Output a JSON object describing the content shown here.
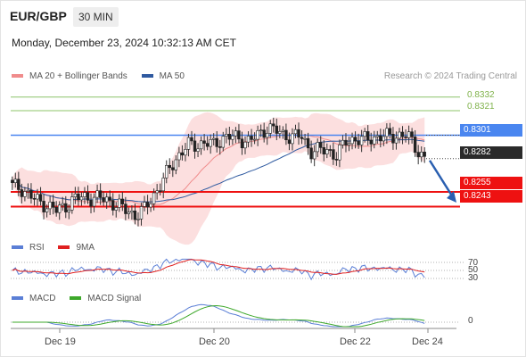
{
  "header": {
    "symbol": "EUR/GBP",
    "timeframe": "30 MIN",
    "timestamp": "Monday, December 23, 2024 10:32:13 AM CET"
  },
  "main_legend": {
    "items": [
      {
        "label": "MA 20 + Bollinger Bands",
        "color": "#f08c8c"
      },
      {
        "label": "MA 50",
        "color": "#2f5aa0"
      }
    ],
    "credit": "Research © 2024 Trading Central"
  },
  "price_labels": {
    "r2": "0.8332",
    "r1": "0.8321",
    "pivot": "0.8301",
    "last": "0.8282",
    "s1": "0.8255",
    "s2": "0.8243"
  },
  "rsi_legend": {
    "items": [
      {
        "label": "RSI",
        "color": "#5b7fd6"
      },
      {
        "label": "9MA",
        "color": "#e02020"
      }
    ],
    "levels": [
      "70",
      "50",
      "30"
    ]
  },
  "macd_legend": {
    "items": [
      {
        "label": "MACD",
        "color": "#5b7fd6"
      },
      {
        "label": "MACD Signal",
        "color": "#3da82a"
      }
    ],
    "zero": "0"
  },
  "x_axis": {
    "labels": [
      "Dec 19",
      "Dec 20",
      "Dec 22",
      "Dec 24"
    ]
  },
  "chart_data": {
    "type": "candlestick",
    "y_range": [
      0.8226,
      0.8342
    ],
    "levels": {
      "r2": 0.8332,
      "r1": 0.8321,
      "pivot": 0.8301,
      "s1": 0.8255,
      "s2": 0.8243,
      "last": 0.8282
    },
    "close_path": [
      0.826,
      0.8258,
      0.8252,
      0.8247,
      0.8244,
      0.824,
      0.8243,
      0.8249,
      0.8251,
      0.825,
      0.825,
      0.8248,
      0.8244,
      0.824,
      0.8236,
      0.824,
      0.8251,
      0.8262,
      0.8275,
      0.8285,
      0.8293,
      0.8293,
      0.8295,
      0.8293,
      0.8299,
      0.83,
      0.8298,
      0.8296,
      0.8301,
      0.8307,
      0.8305,
      0.8301,
      0.83,
      0.83,
      0.8288,
      0.8289,
      0.8289,
      0.8284,
      0.8296,
      0.8298,
      0.8297,
      0.8299,
      0.83,
      0.83,
      0.8301,
      0.8301,
      0.8291,
      0.8282
    ],
    "rsi_levels": [
      70,
      50,
      30
    ]
  }
}
